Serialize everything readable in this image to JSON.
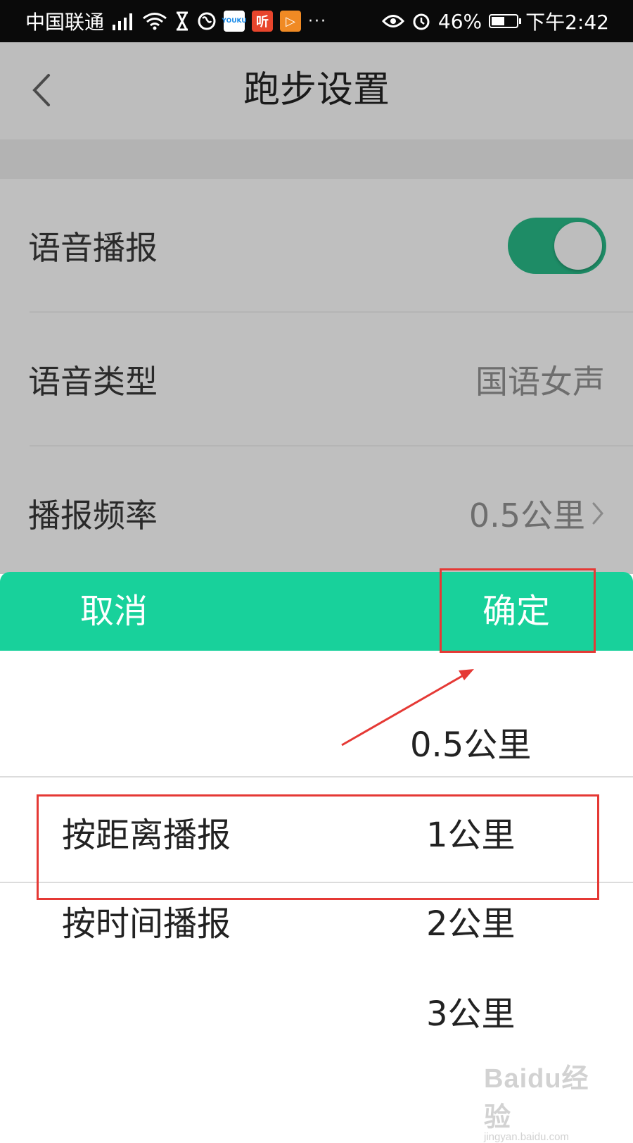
{
  "status_bar": {
    "carrier": "中国联通",
    "app_icons": [
      "YOUKU",
      "听",
      "▷"
    ],
    "more": "···",
    "battery": "46%",
    "time": "下午2:42"
  },
  "nav": {
    "title": "跑步设置"
  },
  "settings": [
    {
      "label": "语音播报",
      "control": "toggle",
      "toggle_on": true
    },
    {
      "label": "语音类型",
      "value": "国语女声"
    },
    {
      "label": "播报频率",
      "value": "0.5公里"
    }
  ],
  "sheet": {
    "cancel_label": "取消",
    "confirm_label": "确定",
    "left_column": [
      "按距离播报",
      "按时间播报"
    ],
    "right_column": [
      "0.5公里",
      "1公里",
      "2公里",
      "3公里"
    ]
  },
  "watermark": {
    "brand": "Baidu经验",
    "url": "jingyan.baidu.com"
  },
  "colors": {
    "accent": "#18d19b",
    "toggle_on": "#1e8c66",
    "annotation_red": "#e53935",
    "overlay": "#bfbfbf"
  },
  "icons": {
    "back": "chevron-left-icon",
    "row_arrow": "chevron-right-icon"
  }
}
